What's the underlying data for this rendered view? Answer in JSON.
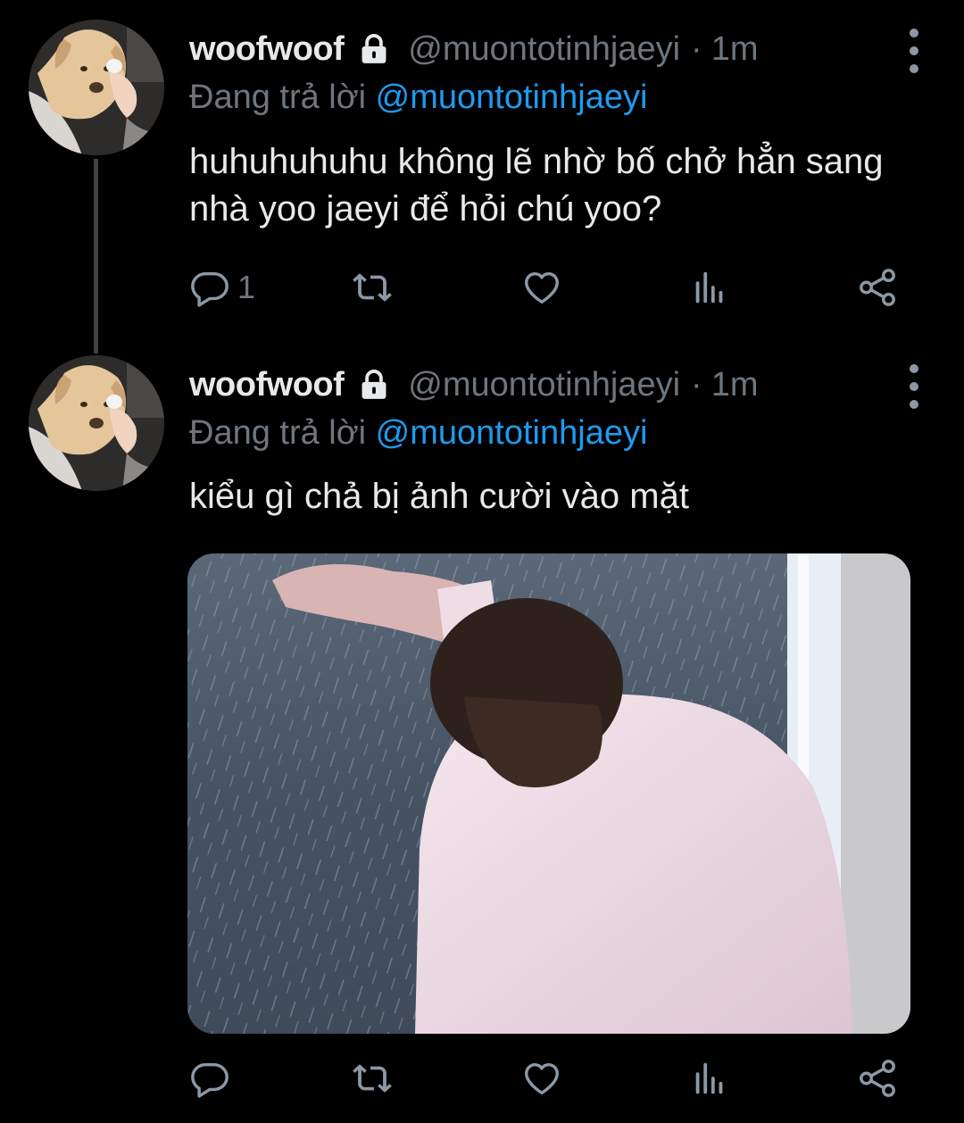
{
  "colors": {
    "background": "#000000",
    "text_primary": "#e7e9ea",
    "text_secondary": "#6e767d",
    "link": "#1d9bf0",
    "thread_line": "#3d4247"
  },
  "tweets": [
    {
      "display_name": "woofwoof",
      "handle": "@muontotinhjaeyi",
      "separator": "·",
      "time": "1m",
      "reply_prefix": "Đang trả lời",
      "reply_handle": "@muontotinhjaeyi",
      "text": "huhuhuhuhu không lẽ nhờ bố chở hẳn sang nhà yoo jaeyi để hỏi chú yoo?",
      "reply_count": "1",
      "icons": [
        "lock-icon",
        "more-icon",
        "reply-icon",
        "retweet-icon",
        "like-icon",
        "views-icon",
        "share-icon"
      ]
    },
    {
      "display_name": "woofwoof",
      "handle": "@muontotinhjaeyi",
      "separator": "·",
      "time": "1m",
      "reply_prefix": "Đang trả lời",
      "reply_handle": "@muontotinhjaeyi",
      "text": "kiểu gì chả bị ảnh cười vào mặt",
      "reply_count": "",
      "has_media": true,
      "icons": [
        "lock-icon",
        "more-icon",
        "reply-icon",
        "retweet-icon",
        "like-icon",
        "views-icon",
        "share-icon"
      ]
    }
  ]
}
